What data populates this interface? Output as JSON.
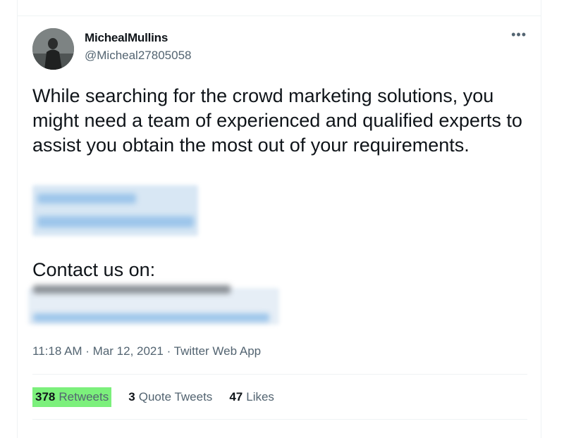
{
  "tweet": {
    "display_name": "MichealMullins",
    "handle": "@Micheal27805058",
    "more_icon": "more-horizontal-icon",
    "text": "While searching for the crowd marketing solutions, you might need a team of experienced and qualified experts to assist you obtain the most out of your requirements.",
    "contact_label": "Contact us on:",
    "timestamp": "11:18 AM · Mar 12, 2021 · Twitter Web App"
  },
  "stats": {
    "retweets": {
      "count": "378",
      "label": "Retweets"
    },
    "quote_tweets": {
      "count": "3",
      "label": "Quote Tweets"
    },
    "likes": {
      "count": "47",
      "label": "Likes"
    }
  },
  "colors": {
    "text": "#0f1419",
    "secondary": "#536471",
    "highlight": "#7cf07c",
    "link_blur": "#9cc5ea"
  }
}
